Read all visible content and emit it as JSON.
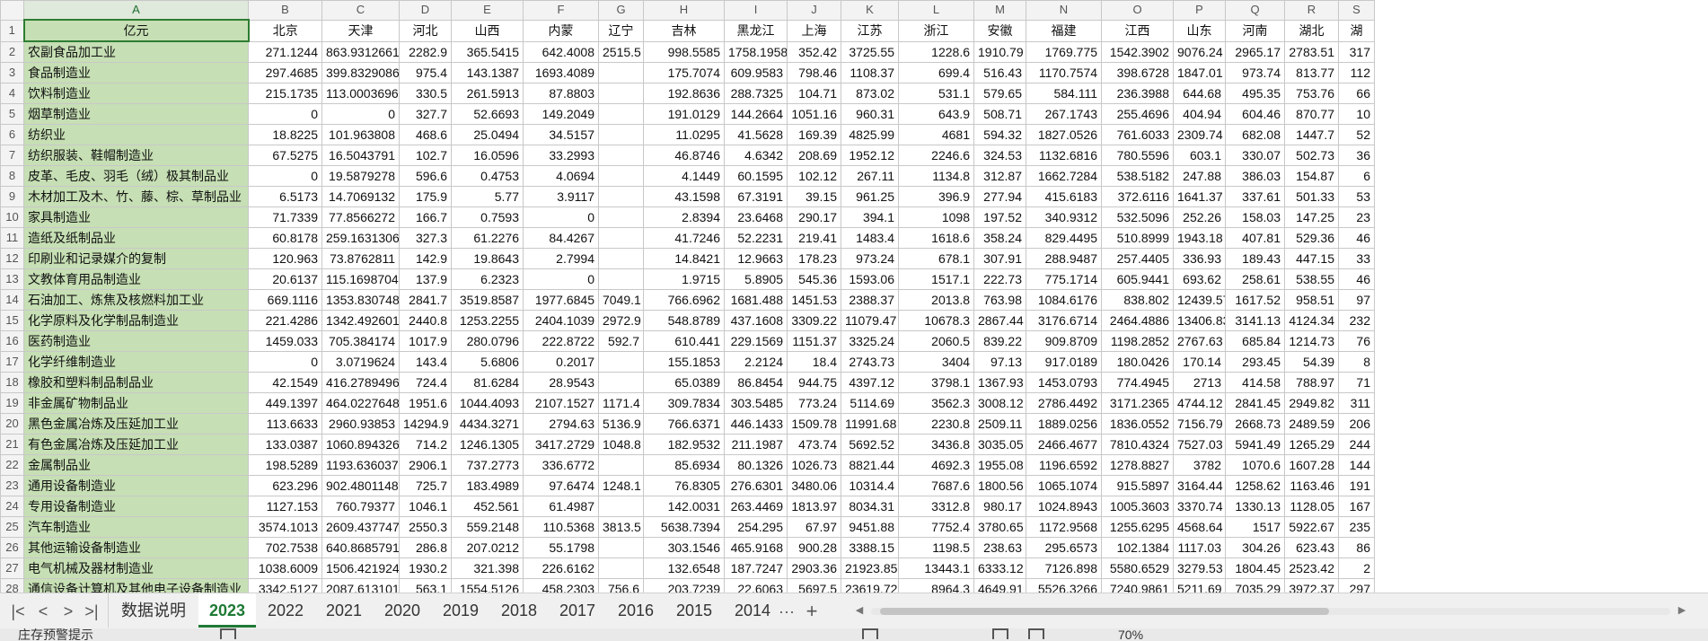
{
  "sheet": {
    "columns": [
      "A",
      "B",
      "C",
      "D",
      "E",
      "F",
      "G",
      "H",
      "I",
      "J",
      "K",
      "L",
      "M",
      "N",
      "O",
      "P",
      "Q",
      "R",
      "S"
    ],
    "selected_column": "A",
    "header_row": {
      "row": "1",
      "label": "亿元",
      "regions": [
        "北京",
        "天津",
        "河北",
        "山西",
        "内蒙",
        "辽宁",
        "吉林",
        "黑龙江",
        "上海",
        "江苏",
        "浙江",
        "安徽",
        "福建",
        "江西",
        "山东",
        "河南",
        "湖北",
        "湖"
      ]
    },
    "rows": [
      {
        "n": "2",
        "label": "农副食品加工业",
        "v": [
          "271.1244",
          "863.9312661",
          "2282.9",
          "365.5415",
          "642.4008",
          "2515.5",
          "998.5585",
          "1758.1958",
          "352.42",
          "3725.55",
          "1228.6",
          "1910.79",
          "1769.775",
          "1542.3902",
          "9076.24",
          "2965.17",
          "2783.51",
          "317"
        ]
      },
      {
        "n": "3",
        "label": "食品制造业",
        "v": [
          "297.4685",
          "399.8329086",
          "975.4",
          "143.1387",
          "1693.4089",
          "",
          "175.7074",
          "609.9583",
          "798.46",
          "1108.37",
          "699.4",
          "516.43",
          "1170.7574",
          "398.6728",
          "1847.01",
          "973.74",
          "813.77",
          "112"
        ]
      },
      {
        "n": "4",
        "label": "饮料制造业",
        "v": [
          "215.1735",
          "113.0003696",
          "330.5",
          "261.5913",
          "87.8803",
          "",
          "192.8636",
          "288.7325",
          "104.71",
          "873.02",
          "531.1",
          "579.65",
          "584.111",
          "236.3988",
          "644.68",
          "495.35",
          "753.76",
          "66"
        ]
      },
      {
        "n": "5",
        "label": "烟草制造业",
        "v": [
          "0",
          "0",
          "327.7",
          "52.6693",
          "149.2049",
          "",
          "191.0129",
          "144.2664",
          "1051.16",
          "960.31",
          "643.9",
          "508.71",
          "267.1743",
          "255.4696",
          "404.94",
          "604.46",
          "870.77",
          "10"
        ]
      },
      {
        "n": "6",
        "label": "纺织业",
        "v": [
          "18.8225",
          "101.963808",
          "468.6",
          "25.0494",
          "34.5157",
          "",
          "11.0295",
          "41.5628",
          "169.39",
          "4825.99",
          "4681",
          "594.32",
          "1827.0526",
          "761.6033",
          "2309.74",
          "682.08",
          "1447.7",
          "52"
        ]
      },
      {
        "n": "7",
        "label": "纺织服装、鞋帽制造业",
        "v": [
          "67.5275",
          "16.5043791",
          "102.7",
          "16.0596",
          "33.2993",
          "",
          "46.8746",
          "4.6342",
          "208.69",
          "1952.12",
          "2246.6",
          "324.53",
          "1132.6816",
          "780.5596",
          "603.1",
          "330.07",
          "502.73",
          "36"
        ]
      },
      {
        "n": "8",
        "label": "皮革、毛皮、羽毛（绒）极其制品业",
        "v": [
          "0",
          "19.5879278",
          "596.6",
          "0.4753",
          "4.0694",
          "",
          "4.1449",
          "60.1595",
          "102.12",
          "267.11",
          "1134.8",
          "312.87",
          "1662.7284",
          "538.5182",
          "247.88",
          "386.03",
          "154.87",
          "6"
        ]
      },
      {
        "n": "9",
        "label": "木材加工及木、竹、藤、棕、草制品业",
        "v": [
          "6.5173",
          "14.7069132",
          "175.9",
          "5.77",
          "3.9117",
          "",
          "43.1598",
          "67.3191",
          "39.15",
          "961.25",
          "396.9",
          "277.94",
          "415.6183",
          "372.6116",
          "1641.37",
          "337.61",
          "501.33",
          "53"
        ]
      },
      {
        "n": "10",
        "label": "家具制造业",
        "v": [
          "71.7339",
          "77.8566272",
          "166.7",
          "0.7593",
          "0",
          "",
          "2.8394",
          "23.6468",
          "290.17",
          "394.1",
          "1098",
          "197.52",
          "340.9312",
          "532.5096",
          "252.26",
          "158.03",
          "147.25",
          "23"
        ]
      },
      {
        "n": "11",
        "label": "造纸及纸制品业",
        "v": [
          "60.8178",
          "259.1631306",
          "327.3",
          "61.2276",
          "84.4267",
          "",
          "41.7246",
          "52.2231",
          "219.41",
          "1483.4",
          "1618.6",
          "358.24",
          "829.4495",
          "510.8999",
          "1943.18",
          "407.81",
          "529.36",
          "46"
        ]
      },
      {
        "n": "12",
        "label": "印刷业和记录媒介的复制",
        "v": [
          "120.963",
          "73.8762811",
          "142.9",
          "19.8643",
          "2.7994",
          "",
          "14.8421",
          "12.9663",
          "178.23",
          "973.24",
          "678.1",
          "307.91",
          "288.9487",
          "257.4405",
          "336.93",
          "189.43",
          "447.15",
          "33"
        ]
      },
      {
        "n": "13",
        "label": "文教体育用品制造业",
        "v": [
          "20.6137",
          "115.1698704",
          "137.9",
          "6.2323",
          "0",
          "",
          "1.9715",
          "5.8905",
          "545.36",
          "1593.06",
          "1517.1",
          "222.73",
          "775.1714",
          "605.9441",
          "693.62",
          "258.61",
          "538.55",
          "46"
        ]
      },
      {
        "n": "14",
        "label": "石油加工、炼焦及核燃料加工业",
        "v": [
          "669.1116",
          "1353.830748",
          "2841.7",
          "3519.8587",
          "1977.6845",
          "7049.1",
          "766.6962",
          "1681.488",
          "1451.53",
          "2388.37",
          "2013.8",
          "763.98",
          "1084.6176",
          "838.802",
          "12439.57",
          "1617.52",
          "958.51",
          "97"
        ]
      },
      {
        "n": "15",
        "label": "化学原料及化学制品制造业",
        "v": [
          "221.4286",
          "1342.492601",
          "2440.8",
          "1253.2255",
          "2404.1039",
          "2972.9",
          "548.8789",
          "437.1608",
          "3309.22",
          "11079.47",
          "10678.3",
          "2867.44",
          "3176.6714",
          "2464.4886",
          "13406.83",
          "3141.13",
          "4124.34",
          "232"
        ]
      },
      {
        "n": "16",
        "label": "医药制造业",
        "v": [
          "1459.033",
          "705.384174",
          "1017.9",
          "280.0796",
          "222.8722",
          "592.7",
          "610.441",
          "229.1569",
          "1151.37",
          "3325.24",
          "2060.5",
          "839.22",
          "909.8709",
          "1198.2852",
          "2767.63",
          "685.84",
          "1214.73",
          "76"
        ]
      },
      {
        "n": "17",
        "label": "化学纤维制造业",
        "v": [
          "0",
          "3.0719624",
          "143.4",
          "5.6806",
          "0.2017",
          "",
          "155.1853",
          "2.2124",
          "18.4",
          "2743.73",
          "3404",
          "97.13",
          "917.0189",
          "180.0426",
          "170.14",
          "293.45",
          "54.39",
          "8"
        ]
      },
      {
        "n": "18",
        "label": "橡胶和塑料制品制品业",
        "v": [
          "42.1549",
          "416.2789496",
          "724.4",
          "81.6284",
          "28.9543",
          "",
          "65.0389",
          "86.8454",
          "944.75",
          "4397.12",
          "3798.1",
          "1367.93",
          "1453.0793",
          "774.4945",
          "2713",
          "414.58",
          "788.97",
          "71"
        ]
      },
      {
        "n": "19",
        "label": "非金属矿物制品业",
        "v": [
          "449.1397",
          "464.0227648",
          "1951.6",
          "1044.4093",
          "2107.1527",
          "1171.4",
          "309.7834",
          "303.5485",
          "773.24",
          "5114.69",
          "3562.3",
          "3008.12",
          "2786.4492",
          "3171.2365",
          "4744.12",
          "2841.45",
          "2949.82",
          "311"
        ]
      },
      {
        "n": "20",
        "label": "黑色金属冶炼及压延加工业",
        "v": [
          "113.6633",
          "2960.93853",
          "14294.9",
          "4434.3271",
          "2794.63",
          "5136.9",
          "766.6371",
          "446.1433",
          "1509.78",
          "11991.68",
          "2230.8",
          "2509.11",
          "1889.0256",
          "1836.0552",
          "7156.79",
          "2668.73",
          "2489.59",
          "206"
        ]
      },
      {
        "n": "21",
        "label": "有色金属冶炼及压延加工业",
        "v": [
          "133.0387",
          "1060.894326",
          "714.2",
          "1246.1305",
          "3417.2729",
          "1048.8",
          "182.9532",
          "211.1987",
          "473.74",
          "5692.52",
          "3436.8",
          "3035.05",
          "2466.4677",
          "7810.4324",
          "7527.03",
          "5941.49",
          "1265.29",
          "244"
        ]
      },
      {
        "n": "22",
        "label": "金属制品业",
        "v": [
          "198.5289",
          "1193.636037",
          "2906.1",
          "737.2773",
          "336.6772",
          "",
          "85.6934",
          "80.1326",
          "1026.73",
          "8821.44",
          "4692.3",
          "1955.08",
          "1196.6592",
          "1278.8827",
          "3782",
          "1070.6",
          "1607.28",
          "144"
        ]
      },
      {
        "n": "23",
        "label": "通用设备制造业",
        "v": [
          "623.296",
          "902.4801148",
          "725.7",
          "183.4989",
          "97.6474",
          "1248.1",
          "76.8305",
          "276.6301",
          "3480.06",
          "10314.4",
          "7687.6",
          "1800.56",
          "1065.1074",
          "915.5897",
          "3164.44",
          "1258.62",
          "1163.46",
          "191"
        ]
      },
      {
        "n": "24",
        "label": "专用设备制造业",
        "v": [
          "1127.153",
          "760.79377",
          "1046.1",
          "452.561",
          "61.4987",
          "",
          "142.0031",
          "263.4469",
          "1813.97",
          "8034.31",
          "3312.8",
          "980.17",
          "1024.8943",
          "1005.3603",
          "3370.74",
          "1330.13",
          "1128.05",
          "167"
        ]
      },
      {
        "n": "25",
        "label": "汽车制造业",
        "v": [
          "3574.1013",
          "2609.437747",
          "2550.3",
          "559.2148",
          "110.5368",
          "3813.5",
          "5638.7394",
          "254.295",
          "67.97",
          "9451.88",
          "7752.4",
          "3780.65",
          "1172.9568",
          "1255.6295",
          "4568.64",
          "1517",
          "5922.67",
          "235"
        ]
      },
      {
        "n": "26",
        "label": "其他运输设备制造业",
        "v": [
          "702.7538",
          "640.8685791",
          "286.8",
          "207.0212",
          "55.1798",
          "",
          "303.1546",
          "465.9168",
          "900.28",
          "3388.15",
          "1198.5",
          "238.63",
          "295.6573",
          "102.1384",
          "1117.03",
          "304.26",
          "623.43",
          "86"
        ]
      },
      {
        "n": "27",
        "label": "电气机械及器材制造业",
        "v": [
          "1038.6009",
          "1506.421924",
          "1930.2",
          "321.398",
          "226.6162",
          "",
          "132.6548",
          "187.7247",
          "2903.36",
          "21923.85",
          "13443.1",
          "6333.12",
          "7126.898",
          "5580.6529",
          "3279.53",
          "1804.45",
          "2523.42",
          "2"
        ]
      },
      {
        "n": "28",
        "label": "通信设备计算机及其他电子设备制造业",
        "v": [
          "3342.5127",
          "2087.613101",
          "563.1",
          "1554.5126",
          "458.2303",
          "756.6",
          "203.7239",
          "22.6063",
          "5697.5",
          "23619.72",
          "8964.3",
          "4649.91",
          "5526.3266",
          "7240.9861",
          "5211.69",
          "7035.29",
          "3972.37",
          "297"
        ]
      }
    ]
  },
  "tabs": [
    "数据说明",
    "2023",
    "2022",
    "2021",
    "2020",
    "2019",
    "2018",
    "2017",
    "2016",
    "2015",
    "2014"
  ],
  "active_tab": "2023",
  "tab_nav": {
    "first": "|<",
    "prev": "<",
    "next": ">",
    "last": ">|",
    "more": "···",
    "add": "+"
  },
  "status": {
    "left_text": "庄存预警提示",
    "zoom": "70%"
  }
}
